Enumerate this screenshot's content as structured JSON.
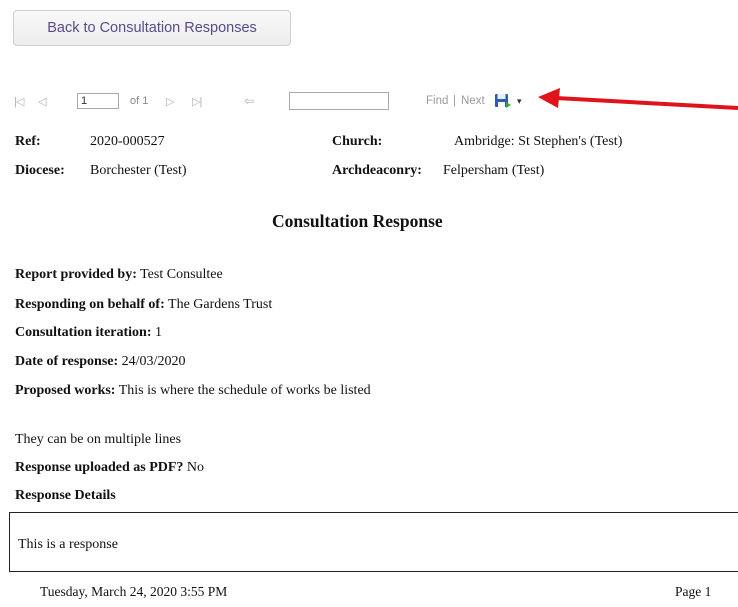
{
  "back_button": {
    "label": "Back to Consultation Responses"
  },
  "toolbar": {
    "first_page": "|◁",
    "prev_page": "◁",
    "page_value": "1",
    "page_of": "of 1",
    "next_page": "▷",
    "last_page": "▷|",
    "back_link": "⇦",
    "find_value": "",
    "find_label": "Find",
    "separator": "|",
    "next_label": "Next",
    "export_dropdown": "▾"
  },
  "header": {
    "ref_label": "Ref:",
    "ref_value": "2020-000527",
    "church_label": "Church:",
    "church_value": "Ambridge: St Stephen's (Test)",
    "diocese_label": "Diocese:",
    "diocese_value": "Borchester (Test)",
    "archdeaconry_label": "Archdeaconry:",
    "archdeaconry_value": "Felpersham (Test)"
  },
  "report": {
    "title": "Consultation Response",
    "provided_by_label": "Report provided by:",
    "provided_by_value": "Test Consultee",
    "on_behalf_label": "Responding on behalf of:",
    "on_behalf_value": "The Gardens Trust",
    "iteration_label": "Consultation iteration:",
    "iteration_value": "1",
    "date_label": "Date of response:",
    "date_value": "24/03/2020",
    "proposed_label": "Proposed works:",
    "proposed_value": "This is where the schedule of works be listed",
    "proposed_line2": "They can be on multiple lines",
    "pdf_label": "Response uploaded as PDF?",
    "pdf_value": "No",
    "details_label": "Response Details",
    "details_value": "This is a response"
  },
  "footer": {
    "timestamp": "Tuesday, March 24, 2020 3:55 PM",
    "page": "Page 1"
  },
  "colors": {
    "button_text": "#5a4a8a",
    "arrow": "#e0131b",
    "save_icon": "#2a5db0"
  }
}
